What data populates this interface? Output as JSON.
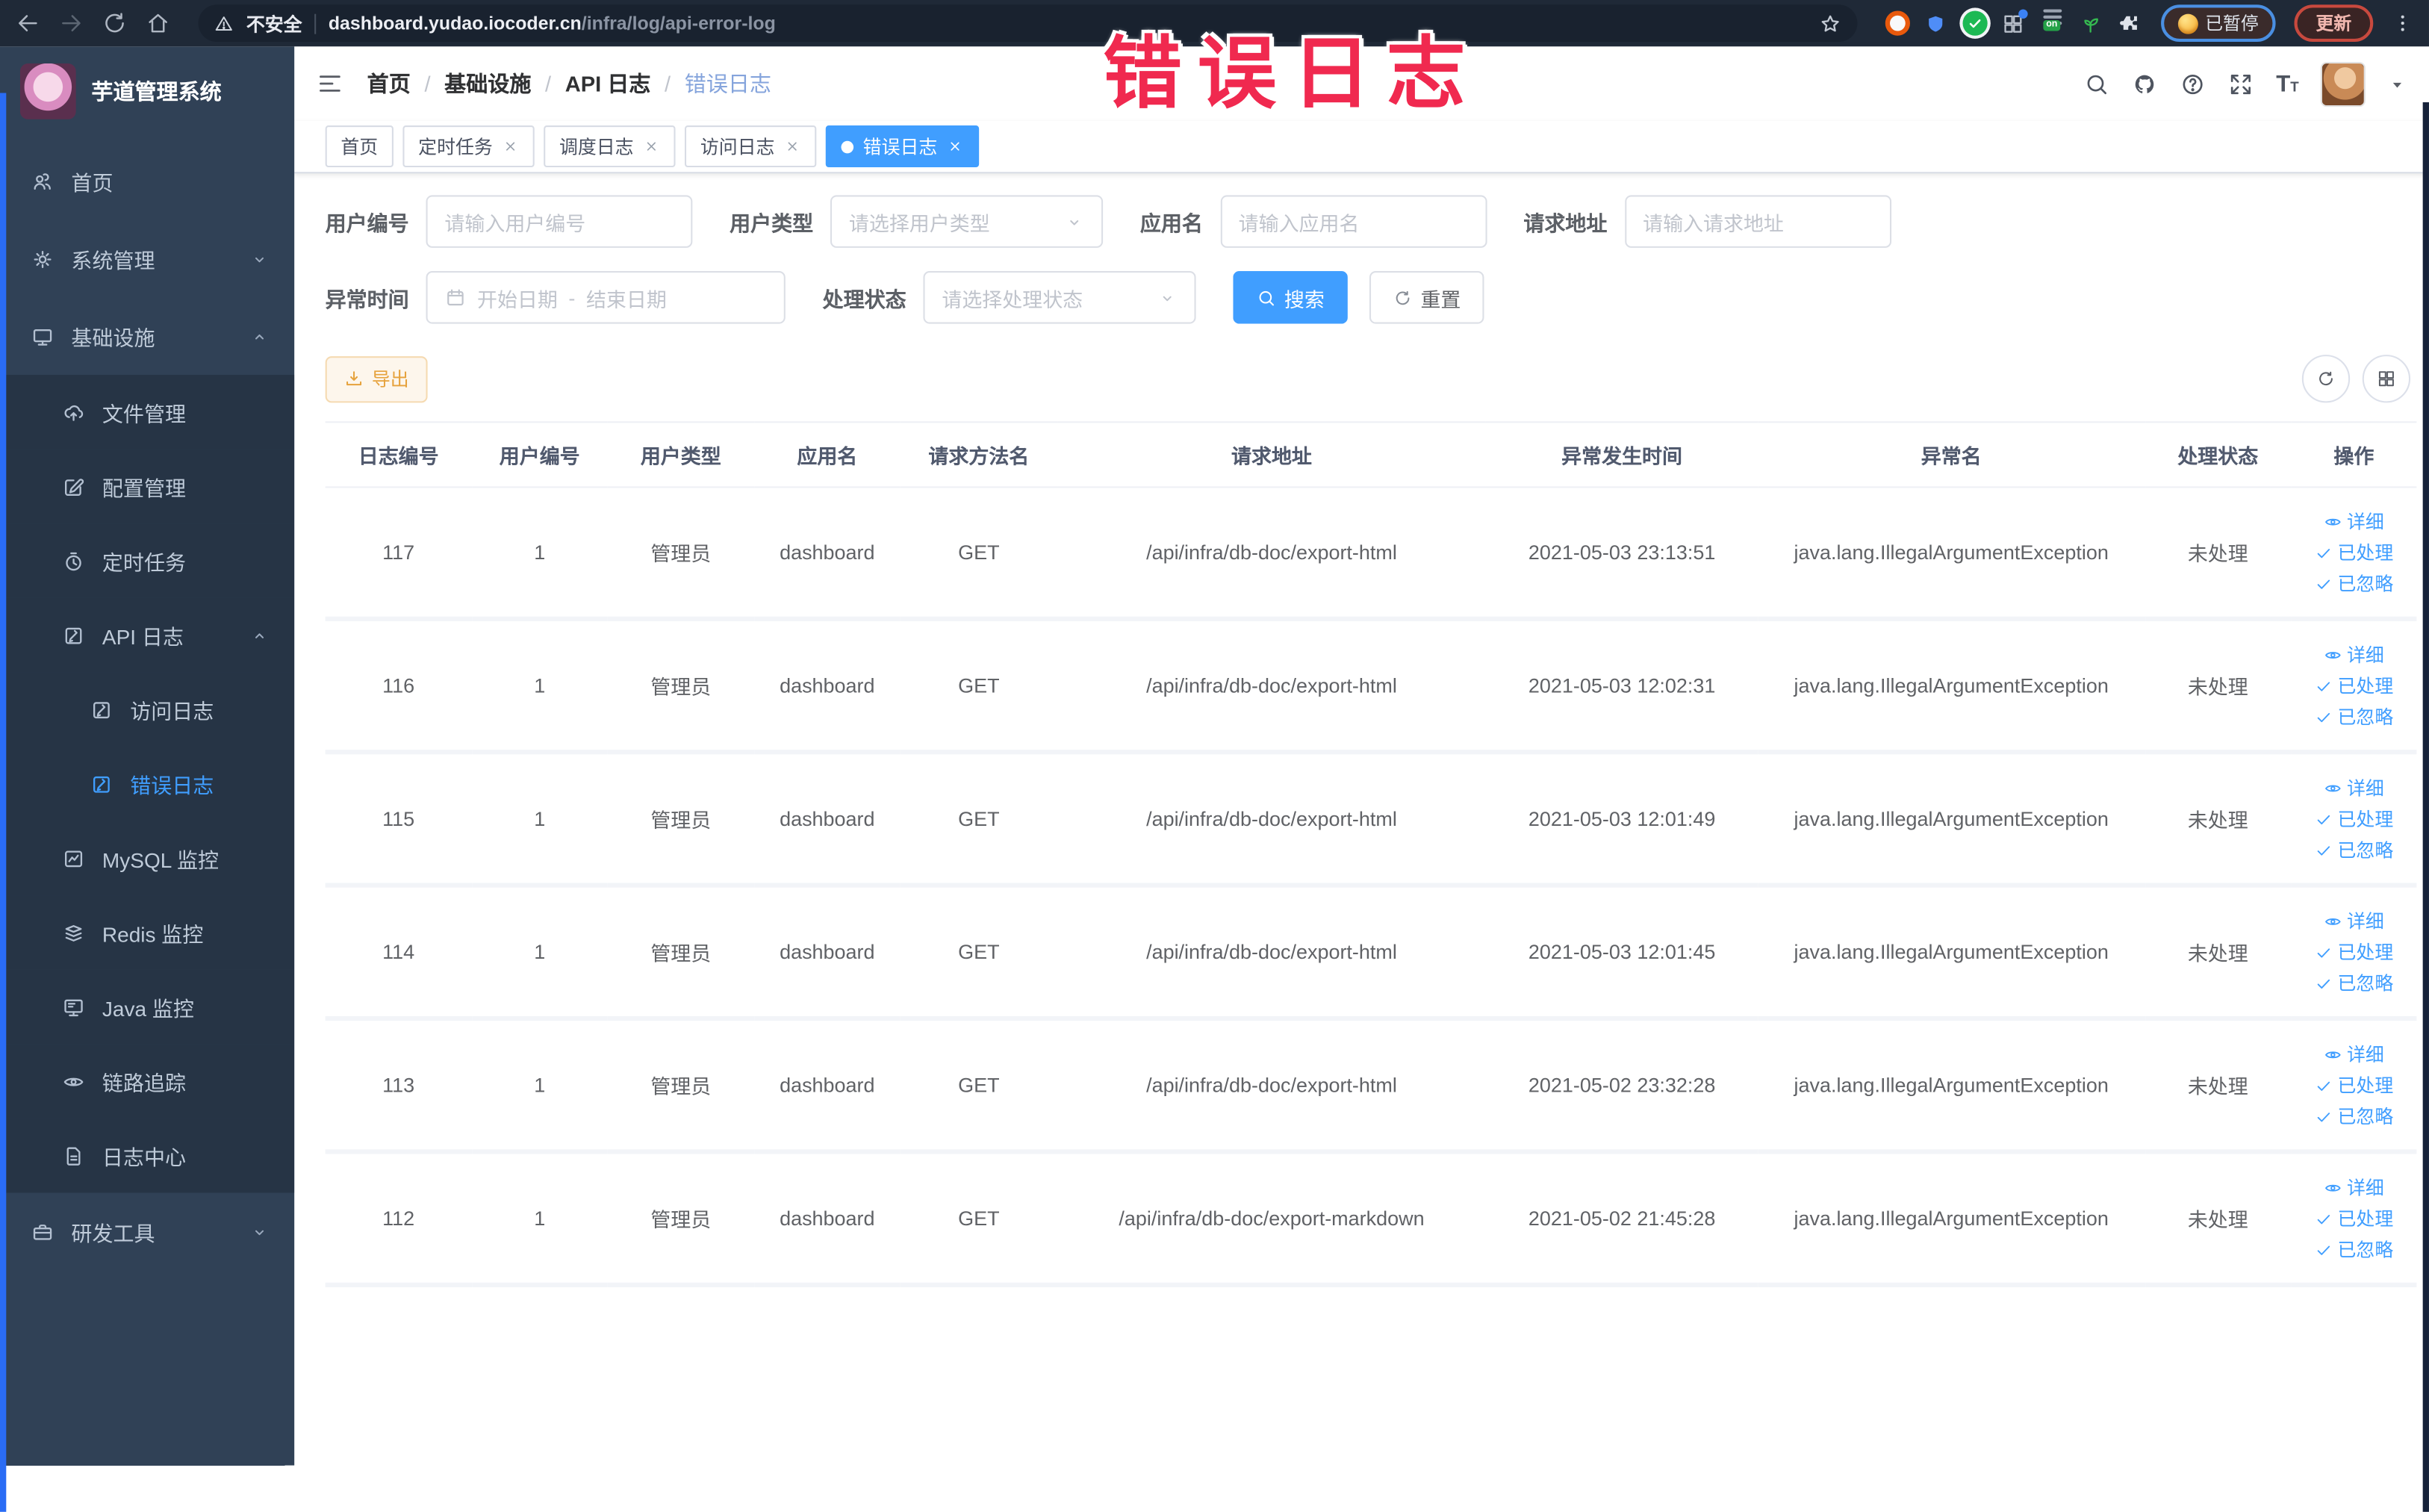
{
  "annotation": {
    "text": "错误日志",
    "color": "#f0294f"
  },
  "browser": {
    "security": "不安全",
    "domain": "dashboard.yudao.iocoder.cn",
    "path": "/infra/log/api-error-log",
    "paused_label": "已暂停",
    "update_label": "更新",
    "extensions": [
      "orange-ring-extension",
      "blue-shield-extension",
      "green-check-extension",
      "grid-extension",
      "on-badge-extension",
      "green-leaf-extension",
      "puzzle-extension"
    ]
  },
  "sidebar": {
    "logo_title": "芋道管理系统",
    "items": [
      {
        "id": "home",
        "label": "首页",
        "icon": "people",
        "level": 0
      },
      {
        "id": "system",
        "label": "系统管理",
        "icon": "gear",
        "level": 0,
        "chevron": "down"
      },
      {
        "id": "infra",
        "label": "基础设施",
        "icon": "monitor",
        "level": 0,
        "chevron": "up"
      },
      {
        "id": "file",
        "label": "文件管理",
        "icon": "cloudup",
        "level": 1
      },
      {
        "id": "config",
        "label": "配置管理",
        "icon": "edit",
        "level": 1
      },
      {
        "id": "job",
        "label": "定时任务",
        "icon": "timer",
        "level": 1
      },
      {
        "id": "api-log",
        "label": "API 日志",
        "icon": "docedit",
        "level": 1,
        "chevron": "up"
      },
      {
        "id": "access-log",
        "label": "访问日志",
        "icon": "docedit",
        "level": 2
      },
      {
        "id": "error-log",
        "label": "错误日志",
        "icon": "docedit",
        "level": 2,
        "active": true
      },
      {
        "id": "mysql",
        "label": "MySQL 监控",
        "icon": "mysql",
        "level": 1
      },
      {
        "id": "redis",
        "label": "Redis 监控",
        "icon": "redis",
        "level": 1
      },
      {
        "id": "java",
        "label": "Java 监控",
        "icon": "java",
        "level": 1
      },
      {
        "id": "trace",
        "label": "链路追踪",
        "icon": "eye",
        "level": 1
      },
      {
        "id": "log-center",
        "label": "日志中心",
        "icon": "doc",
        "level": 1
      },
      {
        "id": "dev-tools",
        "label": "研发工具",
        "icon": "briefcase",
        "level": 0,
        "chevron": "down"
      }
    ]
  },
  "navbar": {
    "breadcrumbs": [
      "首页",
      "基础设施",
      "API 日志",
      "错误日志"
    ],
    "icons": [
      "search",
      "github",
      "help",
      "fullscreen",
      "fontsize"
    ]
  },
  "tabs": [
    {
      "label": "首页",
      "closable": false,
      "active": false
    },
    {
      "label": "定时任务",
      "closable": true,
      "active": false
    },
    {
      "label": "调度日志",
      "closable": true,
      "active": false
    },
    {
      "label": "访问日志",
      "closable": true,
      "active": false
    },
    {
      "label": "错误日志",
      "closable": true,
      "active": true
    }
  ],
  "filters": {
    "rows": [
      [
        {
          "id": "user-id",
          "label": "用户编号",
          "type": "input",
          "placeholder": "请输入用户编号"
        },
        {
          "id": "user-type",
          "label": "用户类型",
          "type": "select",
          "placeholder": "请选择用户类型"
        },
        {
          "id": "app-name",
          "label": "应用名",
          "type": "input",
          "placeholder": "请输入应用名"
        },
        {
          "id": "request-url",
          "label": "请求地址",
          "type": "input",
          "placeholder": "请输入请求地址"
        }
      ],
      [
        {
          "id": "exception-time",
          "label": "异常时间",
          "type": "daterange",
          "start": "开始日期",
          "separator": "-",
          "end": "结束日期"
        },
        {
          "id": "process-status",
          "label": "处理状态",
          "type": "select",
          "placeholder": "请选择处理状态"
        }
      ]
    ],
    "search_label": "搜索",
    "reset_label": "重置"
  },
  "toolbar": {
    "export_label": "导出"
  },
  "table": {
    "headers": [
      "日志编号",
      "用户编号",
      "用户类型",
      "应用名",
      "请求方法名",
      "请求地址",
      "异常发生时间",
      "异常名",
      "处理状态",
      "操作"
    ],
    "col_widths": [
      "7%",
      "6.5%",
      "7%",
      "7%",
      "7.5%",
      "20.5%",
      "13%",
      "18.5%",
      "7%",
      "6%"
    ],
    "rows": [
      {
        "log_id": "117",
        "user_id": "1",
        "user_type": "管理员",
        "app": "dashboard",
        "method": "GET",
        "url": "/api/infra/db-doc/export-html",
        "time": "2021-05-03 23:13:51",
        "exception": "java.lang.IllegalArgumentException",
        "status": "未处理"
      },
      {
        "log_id": "116",
        "user_id": "1",
        "user_type": "管理员",
        "app": "dashboard",
        "method": "GET",
        "url": "/api/infra/db-doc/export-html",
        "time": "2021-05-03 12:02:31",
        "exception": "java.lang.IllegalArgumentException",
        "status": "未处理"
      },
      {
        "log_id": "115",
        "user_id": "1",
        "user_type": "管理员",
        "app": "dashboard",
        "method": "GET",
        "url": "/api/infra/db-doc/export-html",
        "time": "2021-05-03 12:01:49",
        "exception": "java.lang.IllegalArgumentException",
        "status": "未处理"
      },
      {
        "log_id": "114",
        "user_id": "1",
        "user_type": "管理员",
        "app": "dashboard",
        "method": "GET",
        "url": "/api/infra/db-doc/export-html",
        "time": "2021-05-03 12:01:45",
        "exception": "java.lang.IllegalArgumentException",
        "status": "未处理"
      },
      {
        "log_id": "113",
        "user_id": "1",
        "user_type": "管理员",
        "app": "dashboard",
        "method": "GET",
        "url": "/api/infra/db-doc/export-html",
        "time": "2021-05-02 23:32:28",
        "exception": "java.lang.IllegalArgumentException",
        "status": "未处理"
      },
      {
        "log_id": "112",
        "user_id": "1",
        "user_type": "管理员",
        "app": "dashboard",
        "method": "GET",
        "url": "/api/infra/db-doc/export-markdown",
        "time": "2021-05-02 21:45:28",
        "exception": "java.lang.IllegalArgumentException",
        "status": "未处理"
      }
    ],
    "row_actions": [
      {
        "label": "详细",
        "icon": "eyesmall"
      },
      {
        "label": "已处理",
        "icon": "check"
      },
      {
        "label": "已忽略",
        "icon": "check"
      }
    ]
  },
  "colors": {
    "accent": "#409eff",
    "sidebar_bg": "#304156",
    "submenu_bg": "#263445",
    "warning": "#e6a23c",
    "annotation": "#f0294f"
  }
}
